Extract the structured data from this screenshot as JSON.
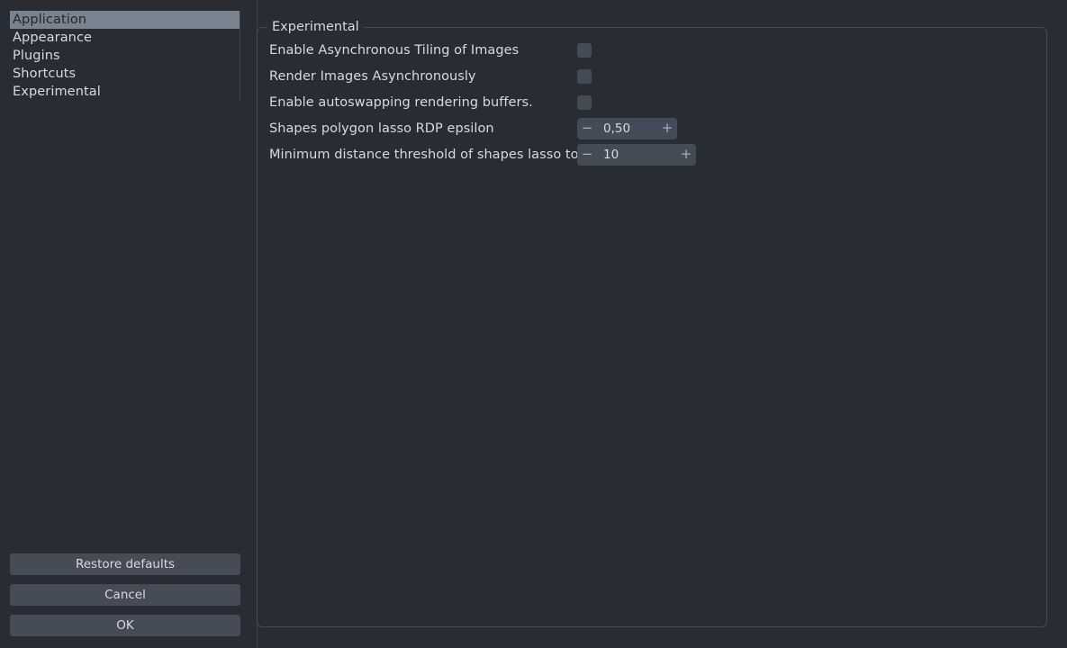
{
  "colors": {
    "window_bg": "#282c35",
    "control_bg": "#434b57",
    "button_bg": "#454b57",
    "selection_bg": "#79838f",
    "selection_fg": "#22262e",
    "text": "#d6dae2",
    "border": "#454b57"
  },
  "sidebar": {
    "categories": [
      {
        "label": "Application",
        "selected": true
      },
      {
        "label": "Appearance",
        "selected": false
      },
      {
        "label": "Plugins",
        "selected": false
      },
      {
        "label": "Shortcuts",
        "selected": false
      },
      {
        "label": "Experimental",
        "selected": false
      }
    ],
    "buttons": [
      {
        "label": "Restore defaults"
      },
      {
        "label": "Cancel"
      },
      {
        "label": "OK"
      }
    ]
  },
  "content": {
    "group_title": "Experimental",
    "rows": [
      {
        "label": "Enable Asynchronous Tiling of Images",
        "control": "checkbox",
        "checked": false
      },
      {
        "label": "Render Images Asynchronously",
        "control": "checkbox",
        "checked": false
      },
      {
        "label": "Enable autoswapping rendering buffers.",
        "control": "checkbox",
        "checked": false
      },
      {
        "label": "Shapes polygon lasso RDP epsilon",
        "control": "spinbox",
        "value": "0,50",
        "decrement": "−",
        "increment": "+"
      },
      {
        "label": "Minimum distance threshold of shapes lasso tool",
        "control": "spinbox",
        "value": "10",
        "decrement": "−",
        "increment": "+"
      }
    ]
  }
}
